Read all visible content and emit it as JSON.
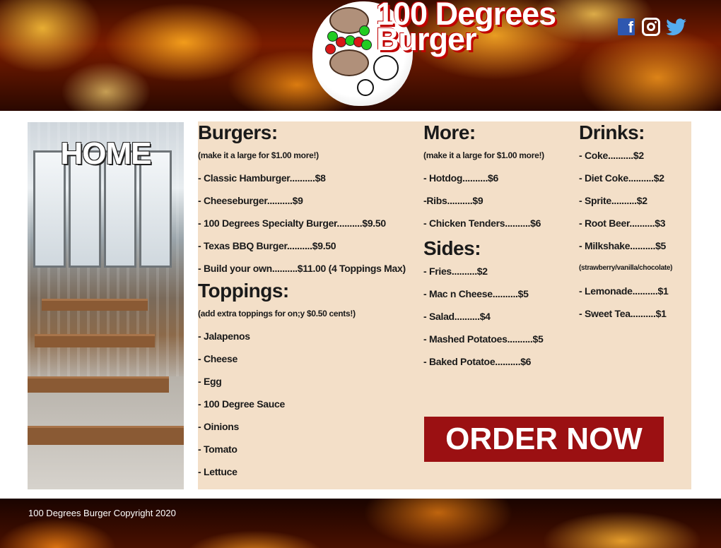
{
  "brand": {
    "title_line1": "100 Degrees",
    "title_line2": "Burger"
  },
  "social": [
    {
      "name": "facebook-icon",
      "glyph": "f",
      "color": "#2e57b0"
    },
    {
      "name": "instagram-icon",
      "color": "#ffffff"
    },
    {
      "name": "twitter-icon",
      "color": "#55acee"
    }
  ],
  "nav": {
    "home_label": "HOME"
  },
  "menu": {
    "burgers": {
      "heading": "Burgers:",
      "note": "(make it a large for $1.00 more!)",
      "items": [
        "- Classic Hamburger..........$8",
        "- Cheeseburger..........$9",
        "- 100 Degrees Specialty Burger..........$9.50",
        "- Texas BBQ Burger..........$9.50",
        "- Build your own..........$11.00 (4  Toppings Max)"
      ]
    },
    "toppings": {
      "heading": "Toppings:",
      "note": "(add extra toppings for on;y $0.50 cents!)",
      "items": [
        "- Jalapenos",
        "- Cheese",
        "- Egg",
        "- 100 Degree Sauce",
        "- Oinions",
        "- Tomato",
        "- Lettuce"
      ]
    },
    "more": {
      "heading": "More:",
      "note": "(make it a large for $1.00 more!)",
      "items": [
        "- Hotdog..........$6",
        "-Ribs..........$9",
        "- Chicken Tenders..........$6"
      ]
    },
    "sides": {
      "heading": "Sides:",
      "items": [
        "- Fries..........$2",
        "- Mac n Cheese..........$5",
        "- Salad..........$4",
        "- Mashed Potatoes..........$5",
        "- Baked Potatoe..........$6"
      ]
    },
    "drinks": {
      "heading": "Drinks:",
      "items": [
        "- Coke..........$2",
        "- Diet Coke..........$2",
        "- Sprite..........$2",
        "- Root Beer..........$3",
        "- Milkshake..........$5"
      ],
      "milkshake_note": "(strawberry/vanilla/chocolate)",
      "items_after": [
        "- Lemonade..........$1",
        "- Sweet Tea..........$1"
      ]
    }
  },
  "order_button": {
    "label": "ORDER NOW",
    "color": "#9b1012"
  },
  "footer": {
    "copyright": "100 Degrees Burger Copyright 2020"
  },
  "colors": {
    "menu_background": "#f3dfc8",
    "title_shadow": "#c00000"
  }
}
